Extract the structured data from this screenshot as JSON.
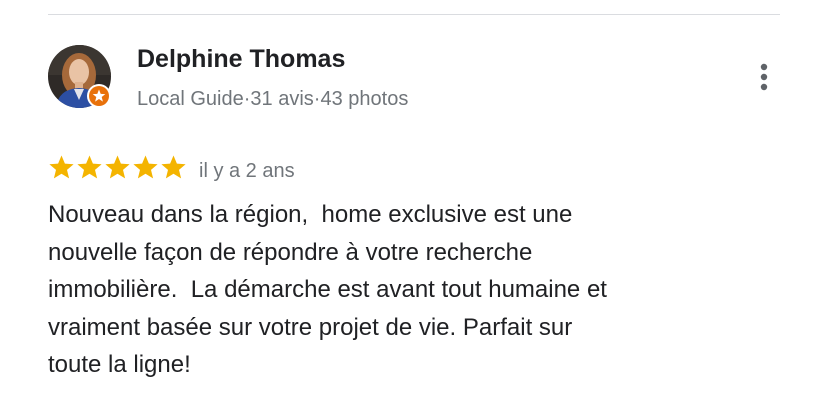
{
  "reviewer": {
    "name": "Delphine Thomas",
    "meta_role": "Local Guide",
    "meta_reviews": "31 avis",
    "meta_photos": "43 photos",
    "separator": "·"
  },
  "review": {
    "rating": 5,
    "rating_max": 5,
    "time": "il y a 2 ans",
    "text_lines": [
      "Nouveau dans la région,  home exclusive est une",
      "nouvelle façon de répondre à votre recherche",
      "immobilière.  La démarche est avant tout humaine et",
      "vraiment basée sur votre projet de vie. Parfait sur",
      "toute la ligne!"
    ]
  },
  "icons": {
    "more": "more-vert-icon",
    "badge": "local-guide-badge-icon",
    "star": "star-icon"
  },
  "colors": {
    "star": "#f4b400",
    "badge": "#e8710a",
    "meta_text": "#70757a",
    "main_text": "#202124",
    "divider": "#dadce0"
  }
}
